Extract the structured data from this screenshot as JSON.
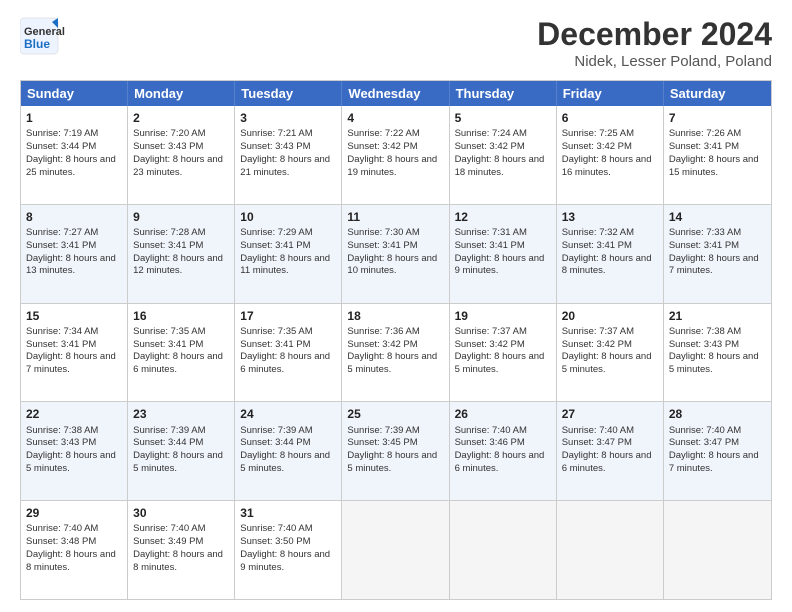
{
  "header": {
    "logo_text_general": "General",
    "logo_text_blue": "Blue",
    "month": "December 2024",
    "location": "Nidek, Lesser Poland, Poland"
  },
  "weekdays": [
    "Sunday",
    "Monday",
    "Tuesday",
    "Wednesday",
    "Thursday",
    "Friday",
    "Saturday"
  ],
  "rows": [
    [
      {
        "day": "1",
        "sunrise": "Sunrise: 7:19 AM",
        "sunset": "Sunset: 3:44 PM",
        "daylight": "Daylight: 8 hours and 25 minutes."
      },
      {
        "day": "2",
        "sunrise": "Sunrise: 7:20 AM",
        "sunset": "Sunset: 3:43 PM",
        "daylight": "Daylight: 8 hours and 23 minutes."
      },
      {
        "day": "3",
        "sunrise": "Sunrise: 7:21 AM",
        "sunset": "Sunset: 3:43 PM",
        "daylight": "Daylight: 8 hours and 21 minutes."
      },
      {
        "day": "4",
        "sunrise": "Sunrise: 7:22 AM",
        "sunset": "Sunset: 3:42 PM",
        "daylight": "Daylight: 8 hours and 19 minutes."
      },
      {
        "day": "5",
        "sunrise": "Sunrise: 7:24 AM",
        "sunset": "Sunset: 3:42 PM",
        "daylight": "Daylight: 8 hours and 18 minutes."
      },
      {
        "day": "6",
        "sunrise": "Sunrise: 7:25 AM",
        "sunset": "Sunset: 3:42 PM",
        "daylight": "Daylight: 8 hours and 16 minutes."
      },
      {
        "day": "7",
        "sunrise": "Sunrise: 7:26 AM",
        "sunset": "Sunset: 3:41 PM",
        "daylight": "Daylight: 8 hours and 15 minutes."
      }
    ],
    [
      {
        "day": "8",
        "sunrise": "Sunrise: 7:27 AM",
        "sunset": "Sunset: 3:41 PM",
        "daylight": "Daylight: 8 hours and 13 minutes."
      },
      {
        "day": "9",
        "sunrise": "Sunrise: 7:28 AM",
        "sunset": "Sunset: 3:41 PM",
        "daylight": "Daylight: 8 hours and 12 minutes."
      },
      {
        "day": "10",
        "sunrise": "Sunrise: 7:29 AM",
        "sunset": "Sunset: 3:41 PM",
        "daylight": "Daylight: 8 hours and 11 minutes."
      },
      {
        "day": "11",
        "sunrise": "Sunrise: 7:30 AM",
        "sunset": "Sunset: 3:41 PM",
        "daylight": "Daylight: 8 hours and 10 minutes."
      },
      {
        "day": "12",
        "sunrise": "Sunrise: 7:31 AM",
        "sunset": "Sunset: 3:41 PM",
        "daylight": "Daylight: 8 hours and 9 minutes."
      },
      {
        "day": "13",
        "sunrise": "Sunrise: 7:32 AM",
        "sunset": "Sunset: 3:41 PM",
        "daylight": "Daylight: 8 hours and 8 minutes."
      },
      {
        "day": "14",
        "sunrise": "Sunrise: 7:33 AM",
        "sunset": "Sunset: 3:41 PM",
        "daylight": "Daylight: 8 hours and 7 minutes."
      }
    ],
    [
      {
        "day": "15",
        "sunrise": "Sunrise: 7:34 AM",
        "sunset": "Sunset: 3:41 PM",
        "daylight": "Daylight: 8 hours and 7 minutes."
      },
      {
        "day": "16",
        "sunrise": "Sunrise: 7:35 AM",
        "sunset": "Sunset: 3:41 PM",
        "daylight": "Daylight: 8 hours and 6 minutes."
      },
      {
        "day": "17",
        "sunrise": "Sunrise: 7:35 AM",
        "sunset": "Sunset: 3:41 PM",
        "daylight": "Daylight: 8 hours and 6 minutes."
      },
      {
        "day": "18",
        "sunrise": "Sunrise: 7:36 AM",
        "sunset": "Sunset: 3:42 PM",
        "daylight": "Daylight: 8 hours and 5 minutes."
      },
      {
        "day": "19",
        "sunrise": "Sunrise: 7:37 AM",
        "sunset": "Sunset: 3:42 PM",
        "daylight": "Daylight: 8 hours and 5 minutes."
      },
      {
        "day": "20",
        "sunrise": "Sunrise: 7:37 AM",
        "sunset": "Sunset: 3:42 PM",
        "daylight": "Daylight: 8 hours and 5 minutes."
      },
      {
        "day": "21",
        "sunrise": "Sunrise: 7:38 AM",
        "sunset": "Sunset: 3:43 PM",
        "daylight": "Daylight: 8 hours and 5 minutes."
      }
    ],
    [
      {
        "day": "22",
        "sunrise": "Sunrise: 7:38 AM",
        "sunset": "Sunset: 3:43 PM",
        "daylight": "Daylight: 8 hours and 5 minutes."
      },
      {
        "day": "23",
        "sunrise": "Sunrise: 7:39 AM",
        "sunset": "Sunset: 3:44 PM",
        "daylight": "Daylight: 8 hours and 5 minutes."
      },
      {
        "day": "24",
        "sunrise": "Sunrise: 7:39 AM",
        "sunset": "Sunset: 3:44 PM",
        "daylight": "Daylight: 8 hours and 5 minutes."
      },
      {
        "day": "25",
        "sunrise": "Sunrise: 7:39 AM",
        "sunset": "Sunset: 3:45 PM",
        "daylight": "Daylight: 8 hours and 5 minutes."
      },
      {
        "day": "26",
        "sunrise": "Sunrise: 7:40 AM",
        "sunset": "Sunset: 3:46 PM",
        "daylight": "Daylight: 8 hours and 6 minutes."
      },
      {
        "day": "27",
        "sunrise": "Sunrise: 7:40 AM",
        "sunset": "Sunset: 3:47 PM",
        "daylight": "Daylight: 8 hours and 6 minutes."
      },
      {
        "day": "28",
        "sunrise": "Sunrise: 7:40 AM",
        "sunset": "Sunset: 3:47 PM",
        "daylight": "Daylight: 8 hours and 7 minutes."
      }
    ],
    [
      {
        "day": "29",
        "sunrise": "Sunrise: 7:40 AM",
        "sunset": "Sunset: 3:48 PM",
        "daylight": "Daylight: 8 hours and 8 minutes."
      },
      {
        "day": "30",
        "sunrise": "Sunrise: 7:40 AM",
        "sunset": "Sunset: 3:49 PM",
        "daylight": "Daylight: 8 hours and 8 minutes."
      },
      {
        "day": "31",
        "sunrise": "Sunrise: 7:40 AM",
        "sunset": "Sunset: 3:50 PM",
        "daylight": "Daylight: 8 hours and 9 minutes."
      },
      null,
      null,
      null,
      null
    ]
  ]
}
